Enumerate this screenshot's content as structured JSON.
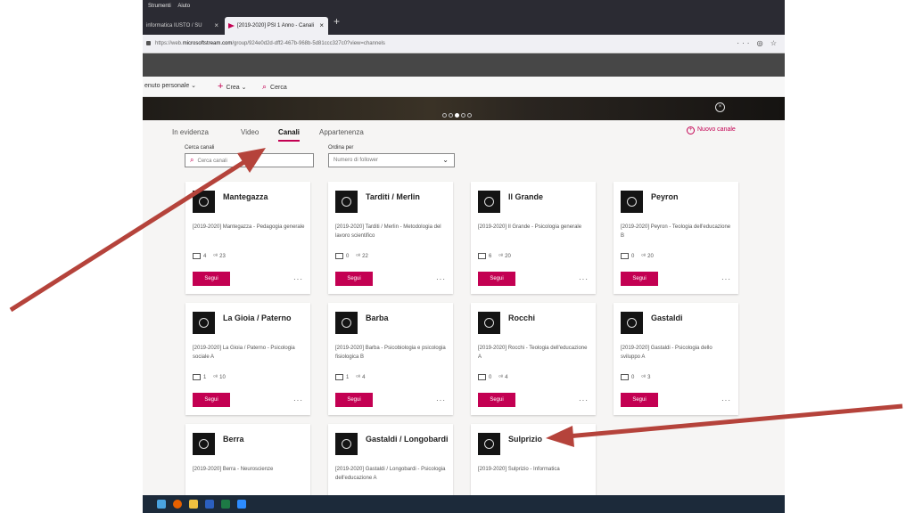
{
  "browser": {
    "menu": [
      "Strumenti",
      "Aiuto"
    ],
    "tabs": [
      {
        "label": "informatica IUSTO / SU"
      },
      {
        "label": "[2019-2020] PSI 1 Anno - Canali"
      }
    ],
    "url_prefix": "https://web.",
    "url_host": "microsoftstream.com",
    "url_path": "/group/924e0d2d-dff2-467b-968b-5d81ccc327c0?view=channels"
  },
  "subnav": {
    "personal": "enuto personale",
    "create": "Crea",
    "search": "Cerca"
  },
  "pivots": [
    {
      "label": "In evidenza"
    },
    {
      "label": "Video"
    },
    {
      "label": "Canali"
    },
    {
      "label": "Appartenenza"
    }
  ],
  "new_channel": "Nuovo canale",
  "search": {
    "label": "Cerca canali",
    "placeholder": "Cerca canali"
  },
  "sort": {
    "label": "Ordina per",
    "value": "Numero di follower"
  },
  "follow_label": "Segui",
  "channels": [
    {
      "name": "Mantegazza",
      "desc": "[2019-2020] Mantegazza - Pedagogia generale",
      "videos": "4",
      "followers": "23"
    },
    {
      "name": "Tarditi / Merlin",
      "desc": "[2019-2020] Tarditi / Merlin - Metodologia del lavoro scientifico",
      "videos": "0",
      "followers": "22"
    },
    {
      "name": "Il Grande",
      "desc": "[2019-2020] Il Grande - Psicologia generale",
      "videos": "6",
      "followers": "20"
    },
    {
      "name": "Peyron",
      "desc": "[2019-2020] Peyron - Teologia dell'educazione B",
      "videos": "0",
      "followers": "20"
    },
    {
      "name": "La Gioia / Paterno",
      "desc": "[2019-2020] La Gioia / Paterno - Psicologia sociale A",
      "videos": "1",
      "followers": "10"
    },
    {
      "name": "Barba",
      "desc": "[2019-2020] Barba - Psicobiologia e psicologia fisiologica B",
      "videos": "1",
      "followers": "4"
    },
    {
      "name": "Rocchi",
      "desc": "[2019-2020] Rocchi - Teologia dell'educazione A",
      "videos": "0",
      "followers": "4"
    },
    {
      "name": "Gastaldi",
      "desc": "[2019-2020] Gastaldi - Psicologia dello sviluppo A",
      "videos": "0",
      "followers": "3"
    },
    {
      "name": "Berra",
      "desc": "[2019-2020] Berra - Neuroscienze",
      "videos": "",
      "followers": ""
    },
    {
      "name": "Gastaldi / Longobardi",
      "desc": "[2019-2020] Gastaldi / Longobardi - Psicologia dell'educazione A",
      "videos": "",
      "followers": ""
    },
    {
      "name": "Sulprizio",
      "desc": "[2019-2020] Sulprizio - Informatica",
      "videos": "",
      "followers": ""
    }
  ],
  "colors": {
    "accent": "#c30052",
    "annotation_arrow": "#b5433b"
  }
}
